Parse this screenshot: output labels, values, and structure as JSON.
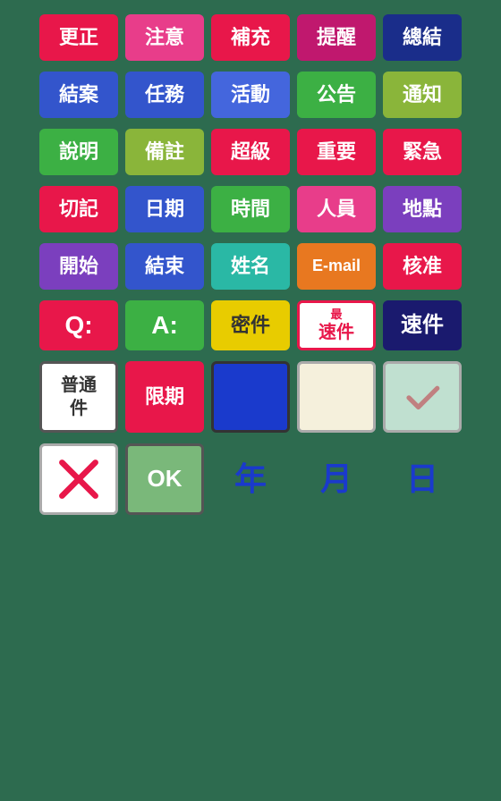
{
  "rows": [
    {
      "id": "row1",
      "items": [
        {
          "id": "gengzheng",
          "label": "更正",
          "color": "red"
        },
        {
          "id": "zhuyi",
          "label": "注意",
          "color": "pink"
        },
        {
          "id": "buchong",
          "label": "補充",
          "color": "red"
        },
        {
          "id": "tixing",
          "label": "提醒",
          "color": "magenta"
        },
        {
          "id": "zongjie",
          "label": "總結",
          "color": "navy"
        }
      ]
    },
    {
      "id": "row2",
      "items": [
        {
          "id": "jian",
          "label": "結案",
          "color": "blue"
        },
        {
          "id": "renwu",
          "label": "任務",
          "color": "blue"
        },
        {
          "id": "huodong",
          "label": "活動",
          "color": "blue2"
        },
        {
          "id": "gonggao",
          "label": "公告",
          "color": "green"
        },
        {
          "id": "tongzhi",
          "label": "通知",
          "color": "olive"
        }
      ]
    },
    {
      "id": "row3",
      "items": [
        {
          "id": "shuoming",
          "label": "說明",
          "color": "green"
        },
        {
          "id": "beizhu",
          "label": "備註",
          "color": "olive"
        },
        {
          "id": "chaoji",
          "label": "超級",
          "color": "red"
        },
        {
          "id": "zhongyao",
          "label": "重要",
          "color": "red"
        },
        {
          "id": "jiji",
          "label": "緊急",
          "color": "red"
        }
      ]
    },
    {
      "id": "row4",
      "items": [
        {
          "id": "qiemi",
          "label": "切記",
          "color": "red"
        },
        {
          "id": "riqi",
          "label": "日期",
          "color": "blue"
        },
        {
          "id": "shijian",
          "label": "時間",
          "color": "green"
        },
        {
          "id": "renyuan",
          "label": "人員",
          "color": "pink"
        },
        {
          "id": "didian",
          "label": "地點",
          "color": "purple"
        }
      ]
    },
    {
      "id": "row5",
      "items": [
        {
          "id": "kaishi",
          "label": "開始",
          "color": "purple"
        },
        {
          "id": "jieshu",
          "label": "結束",
          "color": "blue"
        },
        {
          "id": "xingming",
          "label": "姓名",
          "color": "teal"
        },
        {
          "id": "email",
          "label": "E-mail",
          "color": "orange",
          "special": "email"
        },
        {
          "id": "hejun",
          "label": "核准",
          "color": "red"
        }
      ]
    },
    {
      "id": "row6",
      "items": [
        {
          "id": "q",
          "label": "Q:",
          "color": "red",
          "special": "q"
        },
        {
          "id": "a",
          "label": "A:",
          "color": "green",
          "special": "a"
        },
        {
          "id": "mijan",
          "label": "密件",
          "color": "yellow"
        },
        {
          "id": "zuisujian",
          "label": "最速件",
          "special": "fastest"
        },
        {
          "id": "sujian",
          "label": "速件",
          "color": "dark-navy"
        }
      ]
    },
    {
      "id": "row7",
      "items": [
        {
          "id": "putong",
          "label": "普通件",
          "special": "normal"
        },
        {
          "id": "xianqi",
          "label": "限期",
          "color": "red"
        },
        {
          "id": "solid-blue",
          "special": "solid-blue"
        },
        {
          "id": "blank",
          "special": "blank"
        },
        {
          "id": "check",
          "special": "check"
        }
      ]
    },
    {
      "id": "row8",
      "items": [
        {
          "id": "x-mark",
          "special": "x-mark"
        },
        {
          "id": "ok",
          "label": "OK",
          "special": "ok"
        },
        {
          "id": "year",
          "label": "年",
          "special": "year"
        },
        {
          "id": "month",
          "label": "月",
          "special": "month"
        },
        {
          "id": "day",
          "label": "日",
          "special": "day"
        }
      ]
    }
  ],
  "colors": {
    "red": "#e8174a",
    "pink": "#e83d8a",
    "magenta": "#c0186e",
    "blue": "#3355cc",
    "blue2": "#4466dd",
    "purple": "#7b3fbe",
    "green": "#3cb044",
    "olive": "#8ab53a",
    "teal": "#2ab8a5",
    "orange": "#e87820",
    "yellow": "#e8cc00",
    "dark-navy": "#1a1a6e",
    "navy": "#1a2d8a",
    "cyan": "#00b8d0"
  }
}
